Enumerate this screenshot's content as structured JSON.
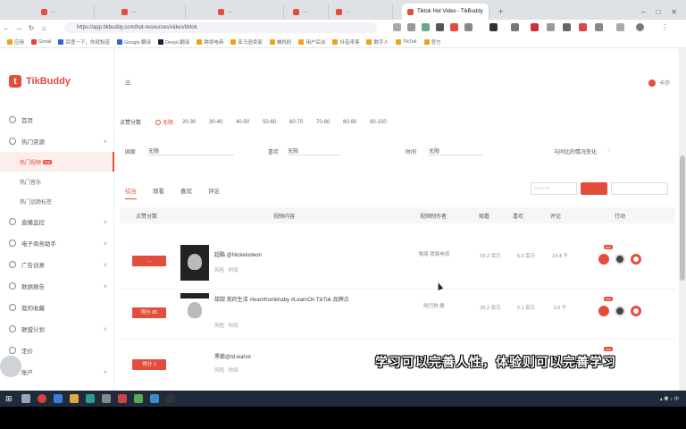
{
  "browser": {
    "tabs": [
      {
        "label": "..."
      },
      {
        "label": "..."
      },
      {
        "label": "..."
      },
      {
        "label": "..."
      },
      {
        "label": "..."
      },
      {
        "label": "Tiktok Hot Video - TikBuddy",
        "active": true
      }
    ],
    "url": "https://app.tikbuddy.com/hot-resources/video/tiktok",
    "bookmarks": [
      "应用",
      "Gmail",
      "百度一下，你就知道",
      "Google 翻译",
      "DeepL翻译",
      "跨境电商",
      "亚马逊卖家",
      "蝉妈妈",
      "用户后台",
      "抖音来客",
      "数字人",
      "TikTok",
      "官方"
    ]
  },
  "app": {
    "name": "TikBuddy",
    "user": "卡尔",
    "accent": "#e34d3c"
  },
  "sidebar": {
    "items": [
      {
        "label": "首页"
      },
      {
        "label": "热门资源",
        "expanded": true,
        "children": [
          {
            "label": "热门视频",
            "active": true,
            "tag": "hot"
          },
          {
            "label": "热门音乐"
          },
          {
            "label": "热门话题标签"
          }
        ]
      },
      {
        "label": "直播监控"
      },
      {
        "label": "电子商务助手"
      },
      {
        "label": "广告创意"
      },
      {
        "label": "数据报告"
      },
      {
        "label": "我的收藏"
      },
      {
        "label": "联盟计划"
      },
      {
        "label": "定价"
      },
      {
        "label": "账户"
      }
    ]
  },
  "filters": {
    "likes_label": "点赞分数",
    "likes_options": [
      "无限",
      "20-30",
      "30-40",
      "40-50",
      "50-60",
      "60-70",
      "70-80",
      "80-90",
      "90-100"
    ],
    "selected_likes": "无限",
    "row2": {
      "a_label": "国家",
      "a_value": "无限",
      "b_label": "喜欢",
      "b_value": "无限",
      "c_label": "时间",
      "c_value": "无限",
      "d_label": "与同比的情况变化"
    }
  },
  "content_tabs": [
    "综合",
    "观看",
    "喜欢",
    "评论"
  ],
  "active_tab": "综合",
  "table": {
    "headers": [
      "点赞分数",
      "视频内容",
      "视频制作者",
      "观看",
      "喜欢",
      "评论",
      "行动"
    ],
    "rows": [
      {
        "score_btn": "...",
        "title": "超酷 @Nickelodeon",
        "meta_left": "风险",
        "meta_right": "时间",
        "creator": "鲁路 铁路电视",
        "views": "59.2 百万",
        "likes": "6.3 百万",
        "comments": "14.4 千"
      },
      {
        "score_btn": "得分 85",
        "title": "甜甜 我的生活 #learnfromkhaby #LearnOn TikTok 品牌点",
        "meta_left": "风险",
        "meta_right": "时间",
        "creator": "哈巴狗 鹿",
        "views": "25.2 百万",
        "likes": "2.1 百万",
        "comments": "3.6 千"
      },
      {
        "score_btn": "得分 1",
        "title": "黑鬃@td.wahot",
        "meta_left": "风险",
        "meta_right": "时间",
        "creator": "",
        "views": "",
        "likes": "",
        "comments": ""
      }
    ]
  },
  "subtitle": "学习可以完善人性，体验则可以完善学习"
}
